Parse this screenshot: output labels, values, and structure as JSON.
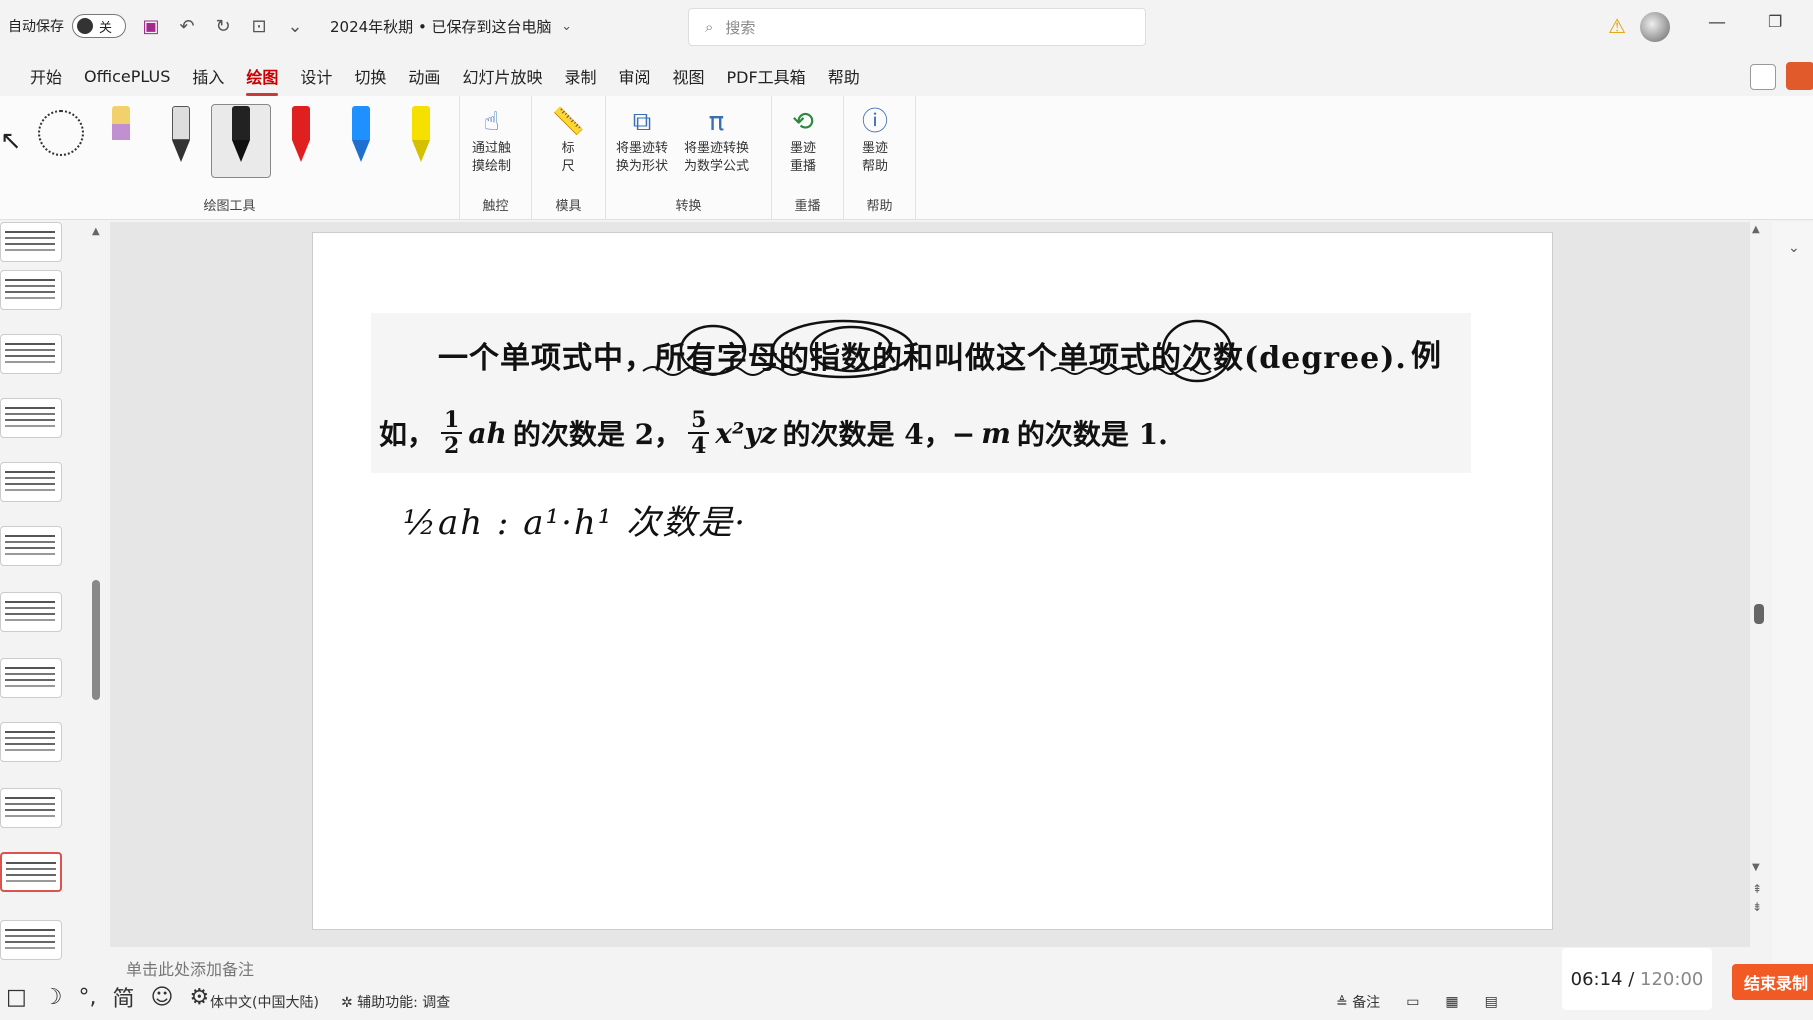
{
  "titlebar": {
    "autosave_label": "自动保存",
    "toggle_label": "关",
    "doc_title": "2024年秋期 • 已保存到这台电脑",
    "search_placeholder": "搜索"
  },
  "menu": {
    "tabs": [
      "开始",
      "OfficePLUS",
      "插入",
      "绘图",
      "设计",
      "切换",
      "动画",
      "幻灯片放映",
      "录制",
      "审阅",
      "视图",
      "PDF工具箱",
      "帮助"
    ],
    "active": "绘图"
  },
  "ribbon": {
    "groups": {
      "drawing_tools": "绘图工具",
      "touch": "触控",
      "stencils": "模具",
      "convert": "转换",
      "replay": "重播",
      "help": "帮助"
    },
    "tools": {
      "touch_draw": [
        "通过触",
        "摸绘制"
      ],
      "ruler": [
        "标",
        "尺"
      ],
      "ink_to_shape": [
        "将墨迹转",
        "换为形状"
      ],
      "ink_to_math": [
        "将墨迹转换",
        "为数学公式"
      ],
      "ink_replay": [
        "墨迹",
        "重播"
      ],
      "ink_help": [
        "墨迹",
        "帮助"
      ]
    },
    "pen_colors": [
      "#f2d06b",
      "#333333",
      "#222222",
      "#e02020",
      "#1e90ff",
      "#f5e000"
    ]
  },
  "slide": {
    "line1": "一个单项式中，所有字母的指数的和叫做这个单项式的次数(degree).",
    "line1_tail": "例",
    "line2": {
      "prefix": "如，",
      "frac1_num": "1",
      "frac1_den": "2",
      "expr1": "ah",
      "mid1": "的次数是 2，",
      "frac2_num": "5",
      "frac2_den": "4",
      "expr2": "x²yz",
      "mid2": "的次数是 4，− ",
      "expr3": "m",
      "suffix": " 的次数是 1."
    },
    "handwriting": "½ah : a¹·h¹  次数是·"
  },
  "notes_placeholder": "单击此处添加备注",
  "statusbar": {
    "language": "体中文(中国大陆)",
    "accessibility": "辅助功能: 调查",
    "notes": "备注"
  },
  "recording": {
    "elapsed": "06:14",
    "total": "120:00",
    "end_label": "结束录制"
  },
  "bottom_tools": [
    "□",
    "☽",
    "°,",
    "简",
    "☺",
    "⚙"
  ]
}
